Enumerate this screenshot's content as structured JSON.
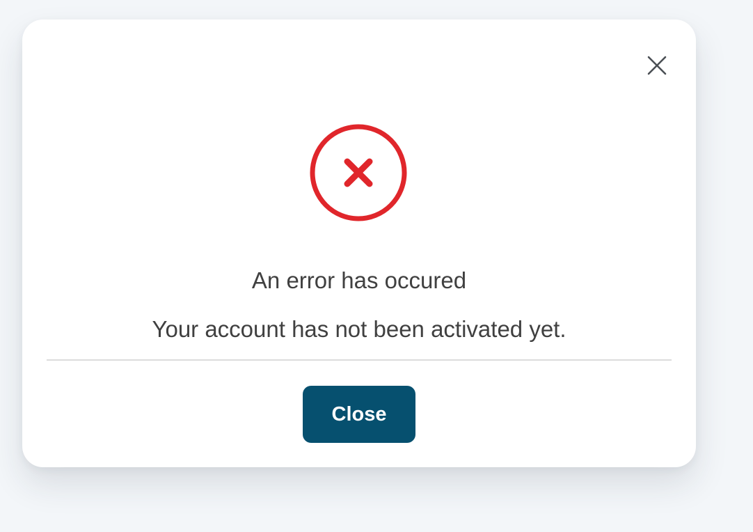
{
  "dialog": {
    "title": "An error has occured",
    "message": "Your account has not been activated yet.",
    "close_button_label": "Close",
    "icons": {
      "dismiss": "close-x-icon",
      "status": "error-circle-x-icon"
    },
    "colors": {
      "error": "#e0262b",
      "button": "#06506f",
      "text": "#404040",
      "dismiss_icon": "#4a4f54"
    }
  }
}
